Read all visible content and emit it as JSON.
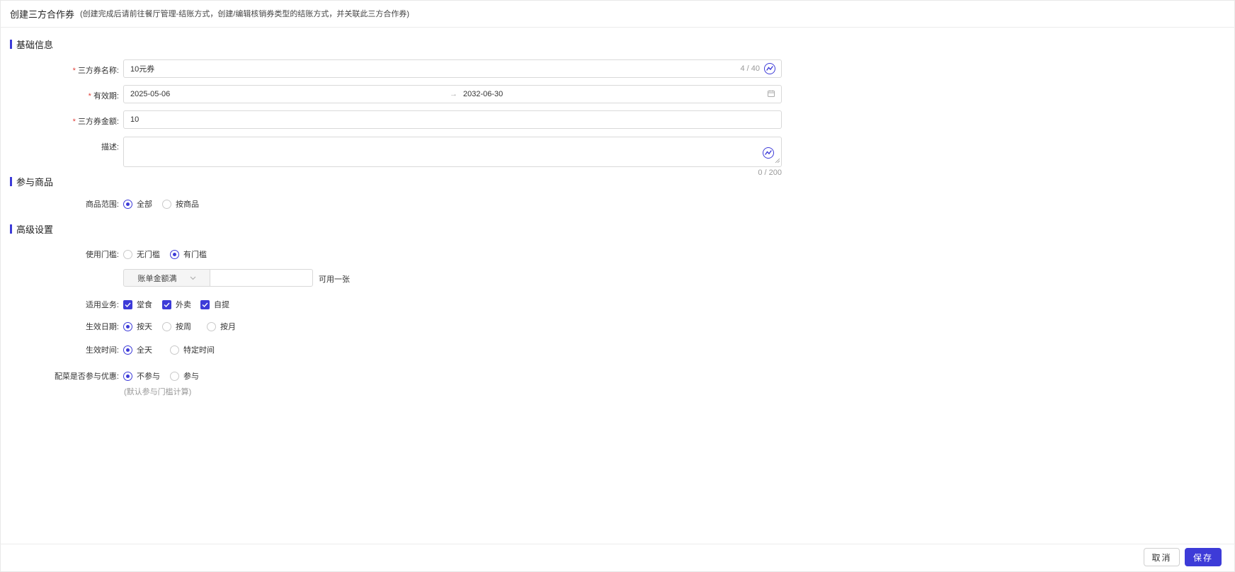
{
  "header": {
    "title": "创建三方合作券",
    "subtitle": "(创建完成后请前往餐厅管理-结账方式，创建/编辑核销券类型的结账方式，并关联此三方合作券)"
  },
  "sections": {
    "basic": "基础信息",
    "goods": "参与商品",
    "advanced": "高级设置"
  },
  "fields": {
    "name": {
      "label": "三方券名称:",
      "value": "10元券",
      "count": "4 / 40",
      "required": true
    },
    "validity": {
      "label": "有效期:",
      "start": "2025-05-06",
      "end": "2032-06-30",
      "required": true
    },
    "amount": {
      "label": "三方券金额:",
      "value": "10",
      "required": true
    },
    "description": {
      "label": "描述:",
      "value": "",
      "count": "0 / 200"
    }
  },
  "goods_scope": {
    "label": "商品范围:",
    "options": [
      "全部",
      "按商品"
    ],
    "selected": 0
  },
  "threshold": {
    "label": "使用门槛:",
    "options": [
      "无门槛",
      "有门槛"
    ],
    "selected": 1,
    "select_value": "账单金额满",
    "input_value": "",
    "suffix": "可用一张"
  },
  "business": {
    "label": "适用业务:",
    "options": [
      "堂食",
      "外卖",
      "自提"
    ],
    "checked": [
      true,
      true,
      true
    ]
  },
  "effective_date": {
    "label": "生效日期:",
    "options": [
      "按天",
      "按周",
      "按月"
    ],
    "selected": 0
  },
  "effective_time": {
    "label": "生效时间:",
    "options": [
      "全天",
      "特定时间"
    ],
    "selected": 0
  },
  "dish_discount": {
    "label": "配菜是否参与优惠:",
    "options": [
      "不参与",
      "参与"
    ],
    "selected": 0,
    "hint": "(默认参与门槛计算)"
  },
  "footer": {
    "cancel_label": "取消",
    "save_label": "保存"
  },
  "colors": {
    "accent": "#3d3bd8",
    "required": "#e0413a"
  }
}
